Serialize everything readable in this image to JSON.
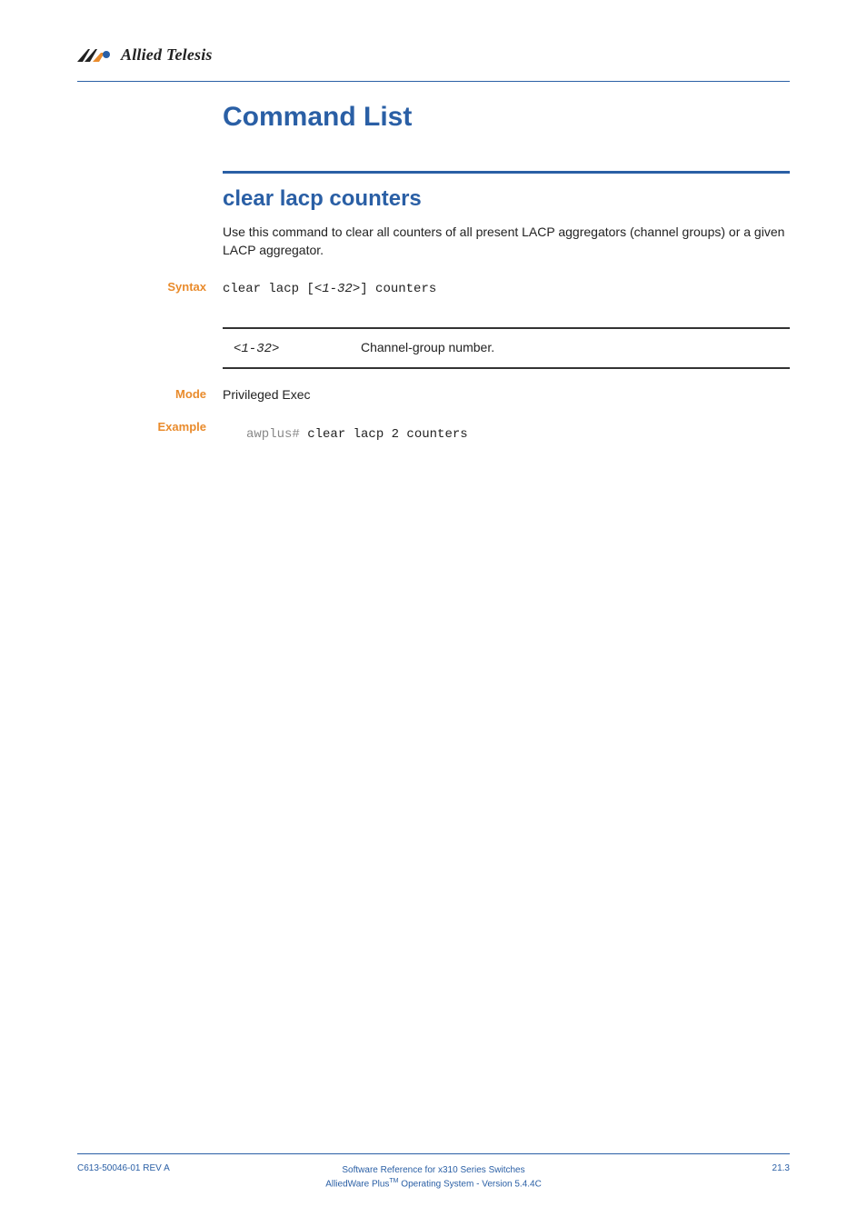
{
  "header": {
    "brand": "Allied Telesis"
  },
  "main": {
    "title": "Command List",
    "command": {
      "heading": "clear lacp counters",
      "description": "Use this command to clear all counters of all present LACP aggregators (channel groups) or a given LACP aggregator.",
      "syntax_label": "Syntax",
      "syntax_prefix": "clear lacp [",
      "syntax_param": "<1-32>",
      "syntax_suffix": "] counters",
      "params": [
        {
          "key": "<1-32>",
          "desc": "Channel-group number."
        }
      ],
      "mode_label": "Mode",
      "mode_value": "Privileged Exec",
      "example_label": "Example",
      "example_prompt": "awplus#",
      "example_cmd": " clear lacp 2 counters"
    }
  },
  "footer": {
    "left": "C613-50046-01 REV A",
    "center_line1": "Software Reference for x310 Series Switches",
    "center_line2_a": "AlliedWare Plus",
    "center_line2_tm": "TM",
    "center_line2_b": " Operating System - Version 5.4.4C",
    "right": "21.3"
  }
}
